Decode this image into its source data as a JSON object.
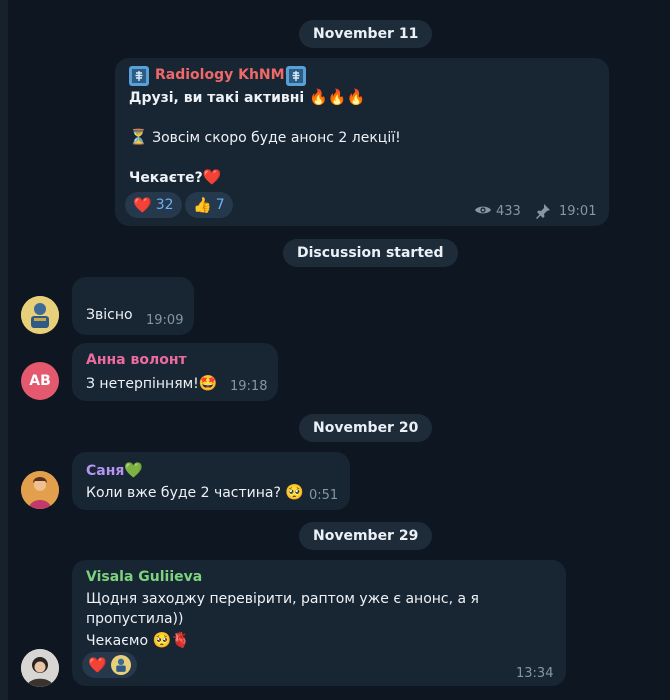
{
  "dates": {
    "nov11": "November 11",
    "nov20": "November 20",
    "nov29": "November 29"
  },
  "service": {
    "discussion": "Discussion started"
  },
  "post": {
    "channel": "Radiology KhNMU",
    "line1": "Друзі, ви такі активні",
    "line1_emoji": "🔥🔥🔥",
    "line2_emoji": "⏳",
    "line2": "Зовсім скоро буде анонс 2 лекції!",
    "line3": "Чекаєте?",
    "line3_emoji": "❤️",
    "reactions": [
      {
        "emoji": "❤️",
        "count": "32"
      },
      {
        "emoji": "👍",
        "count": "7"
      }
    ],
    "views": "433",
    "time": "19:01"
  },
  "messages": [
    {
      "text": "Звісно",
      "time": "19:09"
    },
    {
      "author": "Анна волонт",
      "author_color": "#ee6b9f",
      "avatar_initials": "АВ",
      "text": "З нетерпінням!",
      "text_emoji": "🤩",
      "time": "19:18"
    },
    {
      "author": "Саня",
      "author_emoji": "💚",
      "author_color": "#b694f3",
      "text": "Коли вже буде 2 частина?",
      "text_emoji": "🥺",
      "time": "0:51"
    },
    {
      "author": "Visala Guliieva",
      "author_color": "#7dd37d",
      "line1": "Щодня заходжу перевірити, раптом уже є анонс, а я",
      "line2": "пропустила))",
      "line3": "Чекаємо",
      "line3_emoji": "🥺🫀",
      "reaction_emoji": "❤️",
      "time": "13:34"
    }
  ],
  "colors": {
    "background": "#0e1621",
    "bubble": "#182533",
    "accent": "#6ab2f2",
    "channel_name": "#f06969"
  }
}
